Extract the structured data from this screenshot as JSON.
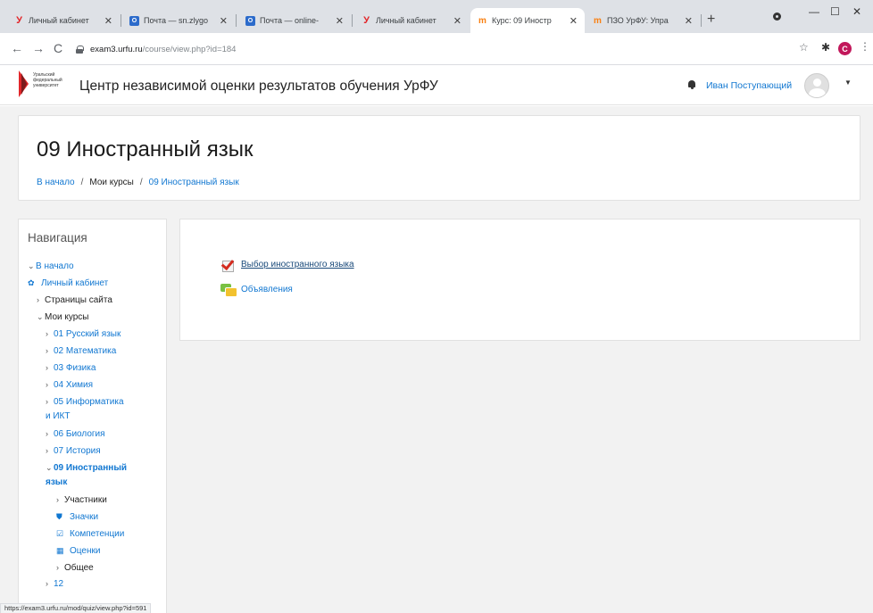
{
  "browser": {
    "tabs": [
      {
        "icon": "urfu-favicon",
        "title": "Личный кабинет",
        "active": false
      },
      {
        "icon": "mail-favicon",
        "title": "Почта — sn.zlygo",
        "active": false
      },
      {
        "icon": "mail-favicon",
        "title": "Почта — online-",
        "active": false
      },
      {
        "icon": "urfu-favicon",
        "title": "Личный кабинет",
        "active": false
      },
      {
        "icon": "moodle-favicon",
        "title": "Курс: 09 Иностр",
        "active": true
      },
      {
        "icon": "moodle-favicon",
        "title": "ПЗО УрФУ: Упра",
        "active": false
      }
    ],
    "profile_initial": "C",
    "url_host": "exam3.urfu.ru",
    "url_path": "/course/view.php?id=184"
  },
  "header": {
    "site_title": "Центр независимой оценки результатов обучения УрФУ",
    "logo_text": "Уральский федеральный университет",
    "user_name": "Иван Поступающий"
  },
  "course": {
    "title": "09 Иностранный язык",
    "breadcrumb": [
      "В начало",
      "Мои курсы",
      "09 Иностранный язык"
    ]
  },
  "navigation": {
    "title": "Навигация",
    "home": "В начало",
    "dashboard": "Личный кабинет",
    "site_pages": "Страницы сайта",
    "my_courses": "Мои курсы",
    "courses": [
      "01 Русский язык",
      "02 Математика",
      "03 Физика",
      "04 Химия",
      "05 Информатика",
      "и ИКТ",
      "06 Биология",
      "07 История"
    ],
    "current_course_line1": "09 Иностранный",
    "current_course_line2": "язык",
    "participants": "Участники",
    "badges": "Значки",
    "competencies": "Компетенции",
    "grades": "Оценки",
    "general": "Общее",
    "truncated": "12"
  },
  "main": {
    "activities": [
      {
        "icon": "choice-icon",
        "label": "Выбор иностранного языка"
      },
      {
        "icon": "forum-icon",
        "label": "Объявления"
      }
    ]
  },
  "status_bar": {
    "url": "https://exam3.urfu.ru/mod/quiz/view.php?id=591"
  }
}
